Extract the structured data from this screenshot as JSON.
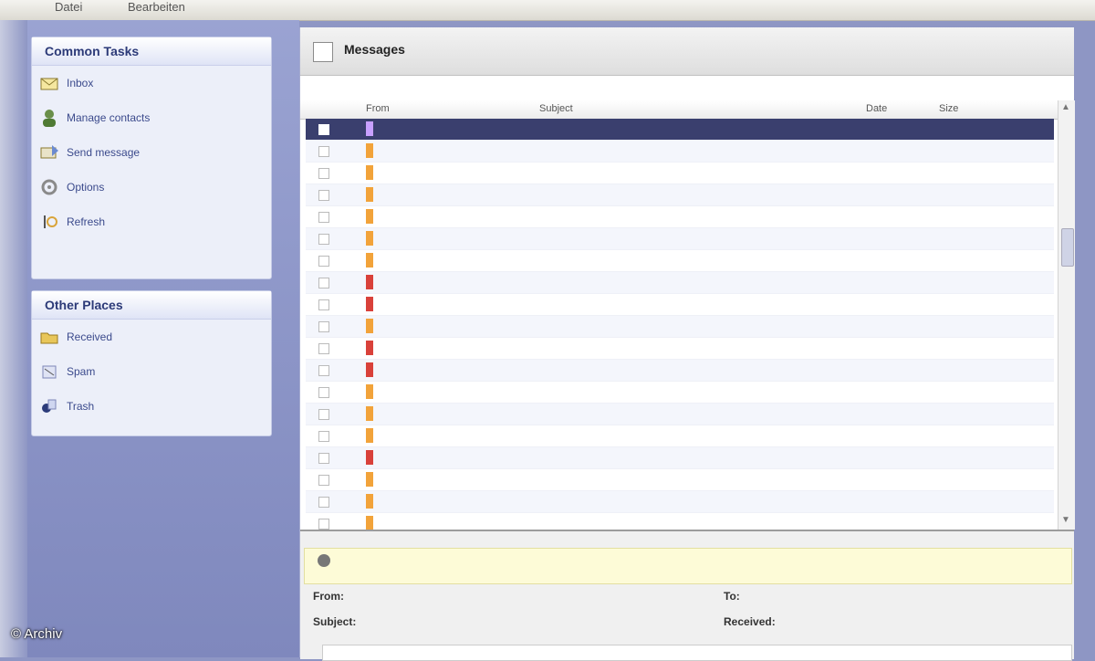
{
  "toolbar": {
    "items": [
      "Datei",
      "Bearbeiten"
    ]
  },
  "sidebar": {
    "panels": [
      {
        "title": "Common Tasks",
        "items": [
          {
            "label": "Inbox",
            "icon": "mail-icon"
          },
          {
            "label": "Manage contacts",
            "icon": "contact-icon"
          },
          {
            "label": "Send message",
            "icon": "send-icon"
          },
          {
            "label": "Options",
            "icon": "gear-icon"
          },
          {
            "label": "Refresh",
            "icon": "refresh-icon"
          }
        ]
      },
      {
        "title": "Other Places",
        "items": [
          {
            "label": "Received",
            "icon": "folder-icon"
          },
          {
            "label": "Spam",
            "icon": "spam-icon"
          },
          {
            "label": "Trash",
            "icon": "trash-icon"
          }
        ]
      }
    ]
  },
  "folder": {
    "title": "Messages"
  },
  "columns": [
    "From",
    "Subject",
    "Date",
    "Size"
  ],
  "rows": [
    {
      "from": "",
      "subject": "",
      "size": "",
      "flag": "#c8a0ff",
      "selected": true
    },
    {
      "from": "",
      "subject": "",
      "size": "",
      "flag": "#f2a33a"
    },
    {
      "from": "",
      "subject": "",
      "size": "",
      "flag": "#f2a33a"
    },
    {
      "from": "",
      "subject": "",
      "size": "",
      "flag": "#f2a33a"
    },
    {
      "from": "",
      "subject": "",
      "size": "",
      "flag": "#f2a33a"
    },
    {
      "from": "",
      "subject": "",
      "size": "",
      "flag": "#f2a33a"
    },
    {
      "from": "",
      "subject": "",
      "size": "",
      "flag": "#f2a33a"
    },
    {
      "from": "",
      "subject": "",
      "size": "",
      "flag": "#d9413a"
    },
    {
      "from": "",
      "subject": "",
      "size": "",
      "flag": "#d9413a"
    },
    {
      "from": "",
      "subject": "",
      "size": "",
      "flag": "#f2a33a"
    },
    {
      "from": "",
      "subject": "",
      "size": "",
      "flag": "#d9413a"
    },
    {
      "from": "",
      "subject": "",
      "size": "",
      "flag": "#d9413a"
    },
    {
      "from": "",
      "subject": "",
      "size": "",
      "flag": "#f2a33a"
    },
    {
      "from": "",
      "subject": "",
      "size": "",
      "flag": "#f2a33a"
    },
    {
      "from": "",
      "subject": "",
      "size": "",
      "flag": "#f2a33a"
    },
    {
      "from": "",
      "subject": "",
      "size": "",
      "flag": "#d9413a"
    },
    {
      "from": "",
      "subject": "",
      "size": "",
      "flag": "#f2a33a"
    },
    {
      "from": "",
      "subject": "",
      "size": "",
      "flag": "#f2a33a"
    },
    {
      "from": "",
      "subject": "",
      "size": "",
      "flag": "#f2a33a"
    }
  ],
  "preview": {
    "info_line1": "",
    "info_line2": "",
    "from_label": "From:",
    "from_value": "",
    "to_label": "To:",
    "subject_label": "Subject:",
    "subject_value": "",
    "received_label": "Received:",
    "received_value": ""
  },
  "watermark": "© Archiv",
  "colors": {
    "sidebar_bg": "#8e96c4",
    "selection": "#3a3f6e",
    "link": "#6b75b2"
  }
}
